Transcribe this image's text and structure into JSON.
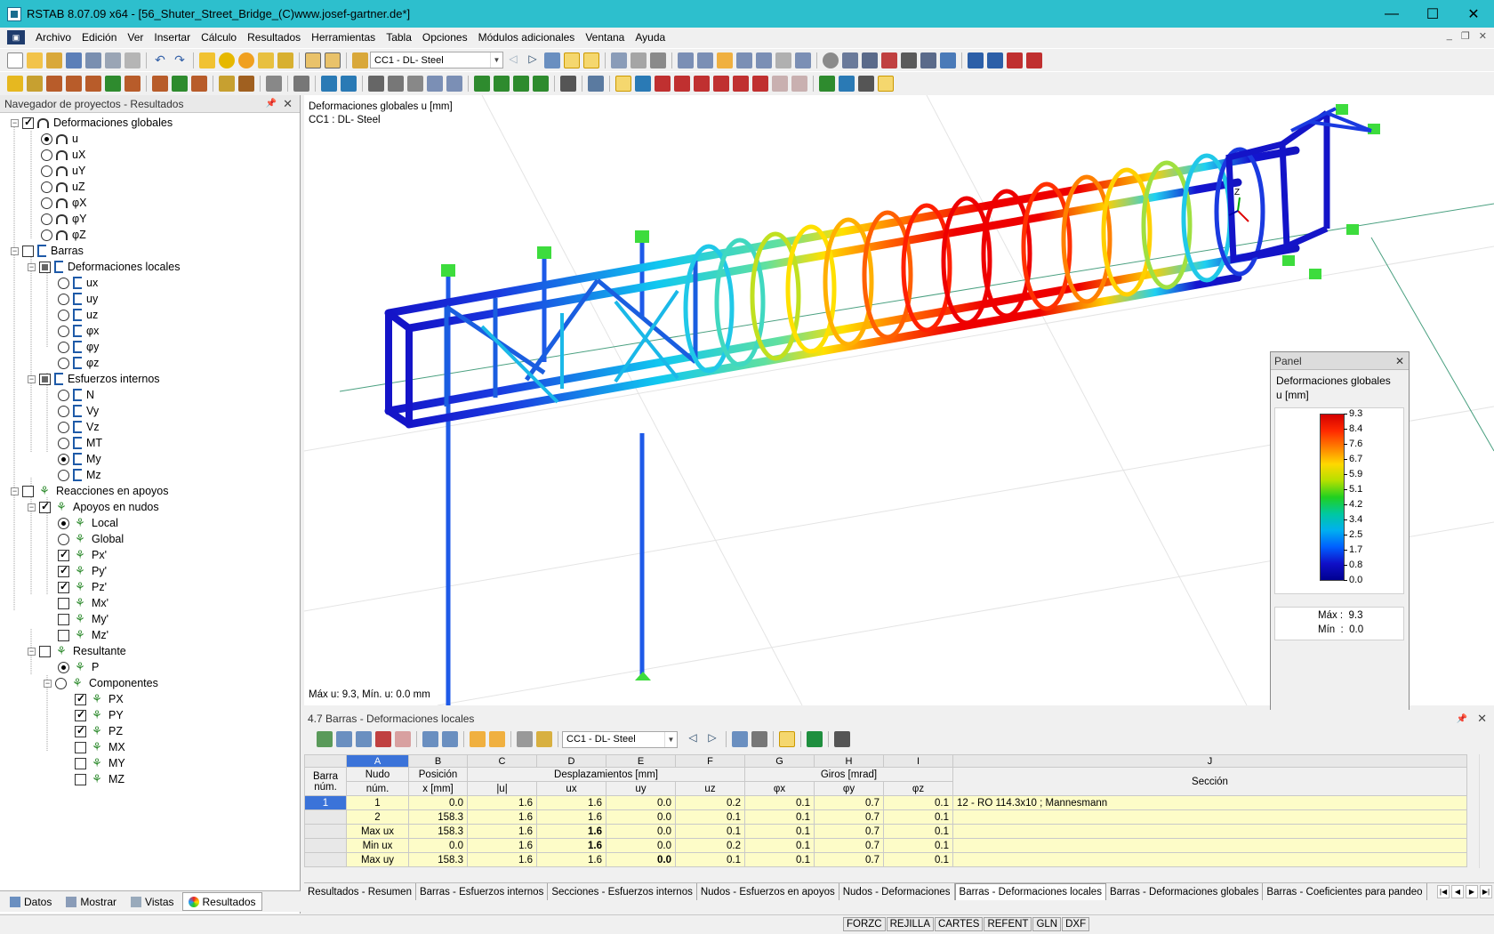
{
  "window": {
    "title": "RSTAB 8.07.09 x64 - [56_Shuter_Street_Bridge_(C)www.josef-gartner.de*]",
    "minimize": "—",
    "maximize": "☐",
    "close": "✕"
  },
  "menu": [
    "Archivo",
    "Edición",
    "Ver",
    "Insertar",
    "Cálculo",
    "Resultados",
    "Herramientas",
    "Tabla",
    "Opciones",
    "Módulos adicionales",
    "Ventana",
    "Ayuda"
  ],
  "toolbar": {
    "load_case": "CC1 - DL- Steel"
  },
  "navigator": {
    "title": "Navegador de proyectos - Resultados",
    "items": [
      {
        "label": "Deformaciones globales"
      },
      {
        "label": "u"
      },
      {
        "label": "uX"
      },
      {
        "label": "uY"
      },
      {
        "label": "uZ"
      },
      {
        "label": "φX"
      },
      {
        "label": "φY"
      },
      {
        "label": "φZ"
      },
      {
        "label": "Barras"
      },
      {
        "label": "Deformaciones locales"
      },
      {
        "label": "ux"
      },
      {
        "label": "uy"
      },
      {
        "label": "uz"
      },
      {
        "label": "φx"
      },
      {
        "label": "φy"
      },
      {
        "label": "φz"
      },
      {
        "label": "Esfuerzos internos"
      },
      {
        "label": "N"
      },
      {
        "label": "Vy"
      },
      {
        "label": "Vz"
      },
      {
        "label": "MT"
      },
      {
        "label": "My"
      },
      {
        "label": "Mz"
      },
      {
        "label": "Reacciones en apoyos"
      },
      {
        "label": "Apoyos en nudos"
      },
      {
        "label": "Local"
      },
      {
        "label": "Global"
      },
      {
        "label": "Px'"
      },
      {
        "label": "Py'"
      },
      {
        "label": "Pz'"
      },
      {
        "label": "Mx'"
      },
      {
        "label": "My'"
      },
      {
        "label": "Mz'"
      },
      {
        "label": "Resultante"
      },
      {
        "label": "P"
      },
      {
        "label": "Componentes"
      },
      {
        "label": "PX"
      },
      {
        "label": "PY"
      },
      {
        "label": "PZ"
      },
      {
        "label": "MX"
      },
      {
        "label": "MY"
      },
      {
        "label": "MZ"
      }
    ],
    "tabs": [
      "Datos",
      "Mostrar",
      "Vistas",
      "Resultados"
    ]
  },
  "viewport": {
    "line1": "Deformaciones globales u [mm]",
    "line2": "CC1 : DL- Steel",
    "footer": "Máx u: 9.3, Mín. u: 0.0 mm",
    "axis_label": "Z"
  },
  "panel": {
    "title": "Panel",
    "heading": "Deformaciones globales",
    "unit": "u [mm]",
    "legend": [
      "9.3",
      "8.4",
      "7.6",
      "6.7",
      "5.9",
      "5.1",
      "4.2",
      "3.4",
      "2.5",
      "1.7",
      "0.8",
      "0.0"
    ],
    "max_label": "Máx",
    "max_value": "9.3",
    "min_label": "Mín",
    "min_value": "0.0"
  },
  "table": {
    "title": "4.7 Barras - Deformaciones locales",
    "load_case": "CC1 - DL- Steel",
    "letters": [
      "A",
      "B",
      "C",
      "D",
      "E",
      "F",
      "G",
      "H",
      "I",
      "J"
    ],
    "h_bar": "Barra",
    "h_bar2": "núm.",
    "h_node": "Nudo",
    "h_node2": "núm.",
    "h_pos": "Posición",
    "h_pos2": "x [mm]",
    "h_disp": "Desplazamientos [mm]",
    "h_rot": "Giros [mrad]",
    "h_sec": "Sección",
    "h_abs": "|u|",
    "h_ux": "ux",
    "h_uy": "uy",
    "h_uz": "uz",
    "h_px": "φx",
    "h_py": "φy",
    "h_pz": "φz",
    "rows": [
      {
        "bar": "1",
        "node": "1",
        "x": "0.0",
        "u": "1.6",
        "ux": "1.6",
        "uy": "0.0",
        "uz": "0.2",
        "px": "0.1",
        "py": "0.7",
        "pz": "0.1",
        "sec": "12 - RO 114.3x10 ; Mannesmann"
      },
      {
        "bar": "",
        "node": "2",
        "x": "158.3",
        "u": "1.6",
        "ux": "1.6",
        "uy": "0.0",
        "uz": "0.1",
        "px": "0.1",
        "py": "0.7",
        "pz": "0.1",
        "sec": ""
      },
      {
        "bar": "",
        "node": "Max ux",
        "x": "158.3",
        "u": "1.6",
        "ux": "1.6",
        "uy": "0.0",
        "uz": "0.1",
        "px": "0.1",
        "py": "0.7",
        "pz": "0.1",
        "sec": ""
      },
      {
        "bar": "",
        "node": "Min ux",
        "x": "0.0",
        "u": "1.6",
        "ux": "1.6",
        "uy": "0.0",
        "uz": "0.2",
        "px": "0.1",
        "py": "0.7",
        "pz": "0.1",
        "sec": ""
      },
      {
        "bar": "",
        "node": "Max uy",
        "x": "158.3",
        "u": "1.6",
        "ux": "1.6",
        "uy": "0.0",
        "uz": "0.1",
        "px": "0.1",
        "py": "0.7",
        "pz": "0.1",
        "sec": ""
      }
    ]
  },
  "bottom_tabs": [
    "Resultados - Resumen",
    "Barras - Esfuerzos internos",
    "Secciones - Esfuerzos internos",
    "Nudos - Esfuerzos en apoyos",
    "Nudos - Deformaciones",
    "Barras - Deformaciones locales",
    "Barras - Deformaciones globales",
    "Barras - Coeficientes para pandeo"
  ],
  "status": [
    "FORZC",
    "REJILLA",
    "CARTES",
    "REFENT",
    "GLN",
    "DXF"
  ]
}
